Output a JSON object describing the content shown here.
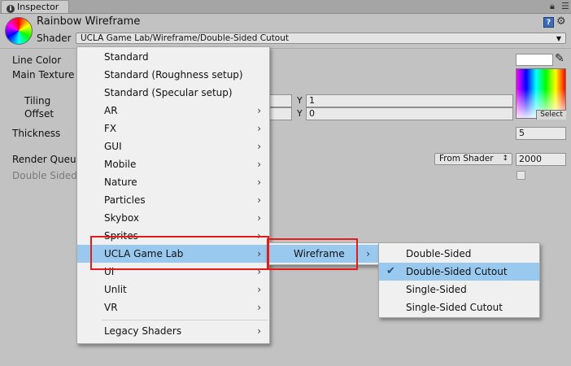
{
  "tab": {
    "label": "Inspector"
  },
  "header": {
    "material_name": "Rainbow Wireframe",
    "shader_label": "Shader",
    "shader_value": "UCLA Game Lab/Wireframe/Double-Sided Cutout",
    "icons": [
      "material-preview-icon",
      "help-book-icon",
      "gear-icon",
      "lock-icon",
      "menu-icon"
    ]
  },
  "properties": {
    "line_color": "Line Color",
    "main_texture": "Main Texture",
    "tiling": "Tiling",
    "offset": "Offset",
    "tiling_y_label": "Y",
    "tiling_y": "1",
    "offset_y_label": "Y",
    "offset_y": "0",
    "thickness": "Thickness",
    "thickness_value": "5",
    "render_queue": "Render Queue",
    "render_queue_mode": "From Shader",
    "render_queue_value": "2000",
    "double_sided_gi": "Double Sided",
    "texture_select": "Select",
    "line_color_hex": "#ffffff"
  },
  "menu_main": [
    {
      "label": "Standard",
      "submenu": false
    },
    {
      "label": "Standard (Roughness setup)",
      "submenu": false
    },
    {
      "label": "Standard (Specular setup)",
      "submenu": false
    },
    {
      "label": "AR",
      "submenu": true
    },
    {
      "label": "FX",
      "submenu": true
    },
    {
      "label": "GUI",
      "submenu": true
    },
    {
      "label": "Mobile",
      "submenu": true
    },
    {
      "label": "Nature",
      "submenu": true
    },
    {
      "label": "Particles",
      "submenu": true
    },
    {
      "label": "Skybox",
      "submenu": true
    },
    {
      "label": "Sprites",
      "submenu": true
    },
    {
      "label": "UCLA Game Lab",
      "submenu": true,
      "highlighted": true
    },
    {
      "label": "UI",
      "submenu": true
    },
    {
      "label": "Unlit",
      "submenu": true
    },
    {
      "label": "VR",
      "submenu": true
    },
    {
      "label": "Legacy Shaders",
      "submenu": true
    }
  ],
  "menu_sub1": [
    {
      "label": "Wireframe",
      "submenu": true,
      "highlighted": true
    }
  ],
  "menu_sub2": [
    {
      "label": "Double-Sided",
      "checked": false
    },
    {
      "label": "Double-Sided Cutout",
      "checked": true
    },
    {
      "label": "Single-Sided",
      "checked": false
    },
    {
      "label": "Single-Sided Cutout",
      "checked": false
    }
  ],
  "colors": {
    "highlight": "#99c9ef",
    "annotation_red": "#e41b1b",
    "panel": "#c2c2c2"
  }
}
